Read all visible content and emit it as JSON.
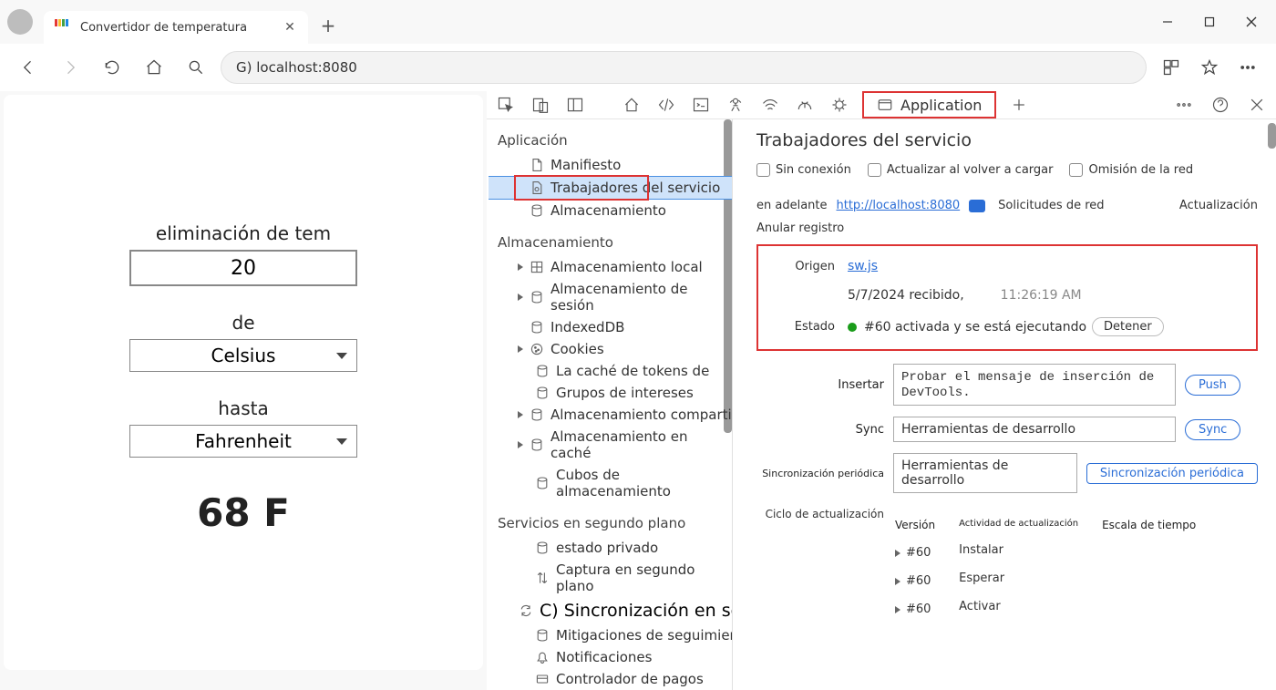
{
  "titlebar": {
    "tab_title": "Convertidor de temperatura"
  },
  "address": {
    "url": "G) localhost:8080"
  },
  "app_page": {
    "field1_label": "eliminación de tem",
    "field1_value": "20",
    "from_label": "de",
    "from_value": "Celsius",
    "to_label": "hasta",
    "to_value": "Fahrenheit",
    "result": "68 F"
  },
  "devtools_bar": {
    "application_tab": "Application"
  },
  "sidebar": {
    "section_app": "Aplicación",
    "manifest": "Manifiesto",
    "sw": "Trabajadores del servicio",
    "storage": "Almacenamiento",
    "section_storage": "Almacenamiento",
    "local": "Almacenamiento local",
    "session": "Almacenamiento de sesión",
    "idb": "IndexedDB",
    "cookies": "Cookies",
    "tokens": "La caché de tokens de",
    "interest": "Grupos de intereses",
    "shared": "Almacenamiento compartido",
    "cache": "Almacenamiento en caché",
    "buckets": "Cubos de almacenamiento",
    "section_bg": "Servicios en segundo plano",
    "priv": "estado privado",
    "bgfetch": "Captura en segundo plano",
    "bgsync": "C) Sincronización en segundo plano",
    "bounce": "Mitigaciones de seguimiento de rebote",
    "notif": "Notificaciones",
    "pay": "Controlador de pagos"
  },
  "main": {
    "title": "Trabajadores del servicio",
    "ck_offline": "Sin conexión",
    "ck_update": "Actualizar al volver a cargar",
    "ck_bypass": "Omisión de la red",
    "sw_prefix": "en adelante",
    "sw_url": "http://localhost:8080",
    "netreq": "Solicitudes de red",
    "update": "Actualización",
    "unreg": "Anular registro",
    "origin_lbl": "Origen",
    "origin_link": "sw.js",
    "received": "5/7/2024 recibido,",
    "received_time": "11:26:19 AM",
    "state_lbl": "Estado",
    "state_text": "#60 activada y se está ejecutando",
    "stop": "Detener",
    "push_lbl": "Insertar",
    "push_val": "Probar el mensaje de inserción de DevTools.",
    "push_btn": "Push",
    "sync_lbl": "Sync",
    "sync_val": "Herramientas de desarrollo",
    "sync_btn": "Sync",
    "per_lbl": "Sincronización periódica",
    "per_val": "Herramientas de desarrollo",
    "per_btn": "Sincronización periódica",
    "lc_lbl": "Ciclo de actualización",
    "lc_version": "Versión",
    "lc_activity": "Actividad de actualización",
    "lc_timeline": "Escala de tiempo",
    "v60": "#60",
    "install": "Instalar",
    "wait": "Esperar",
    "activate": "Activar"
  }
}
